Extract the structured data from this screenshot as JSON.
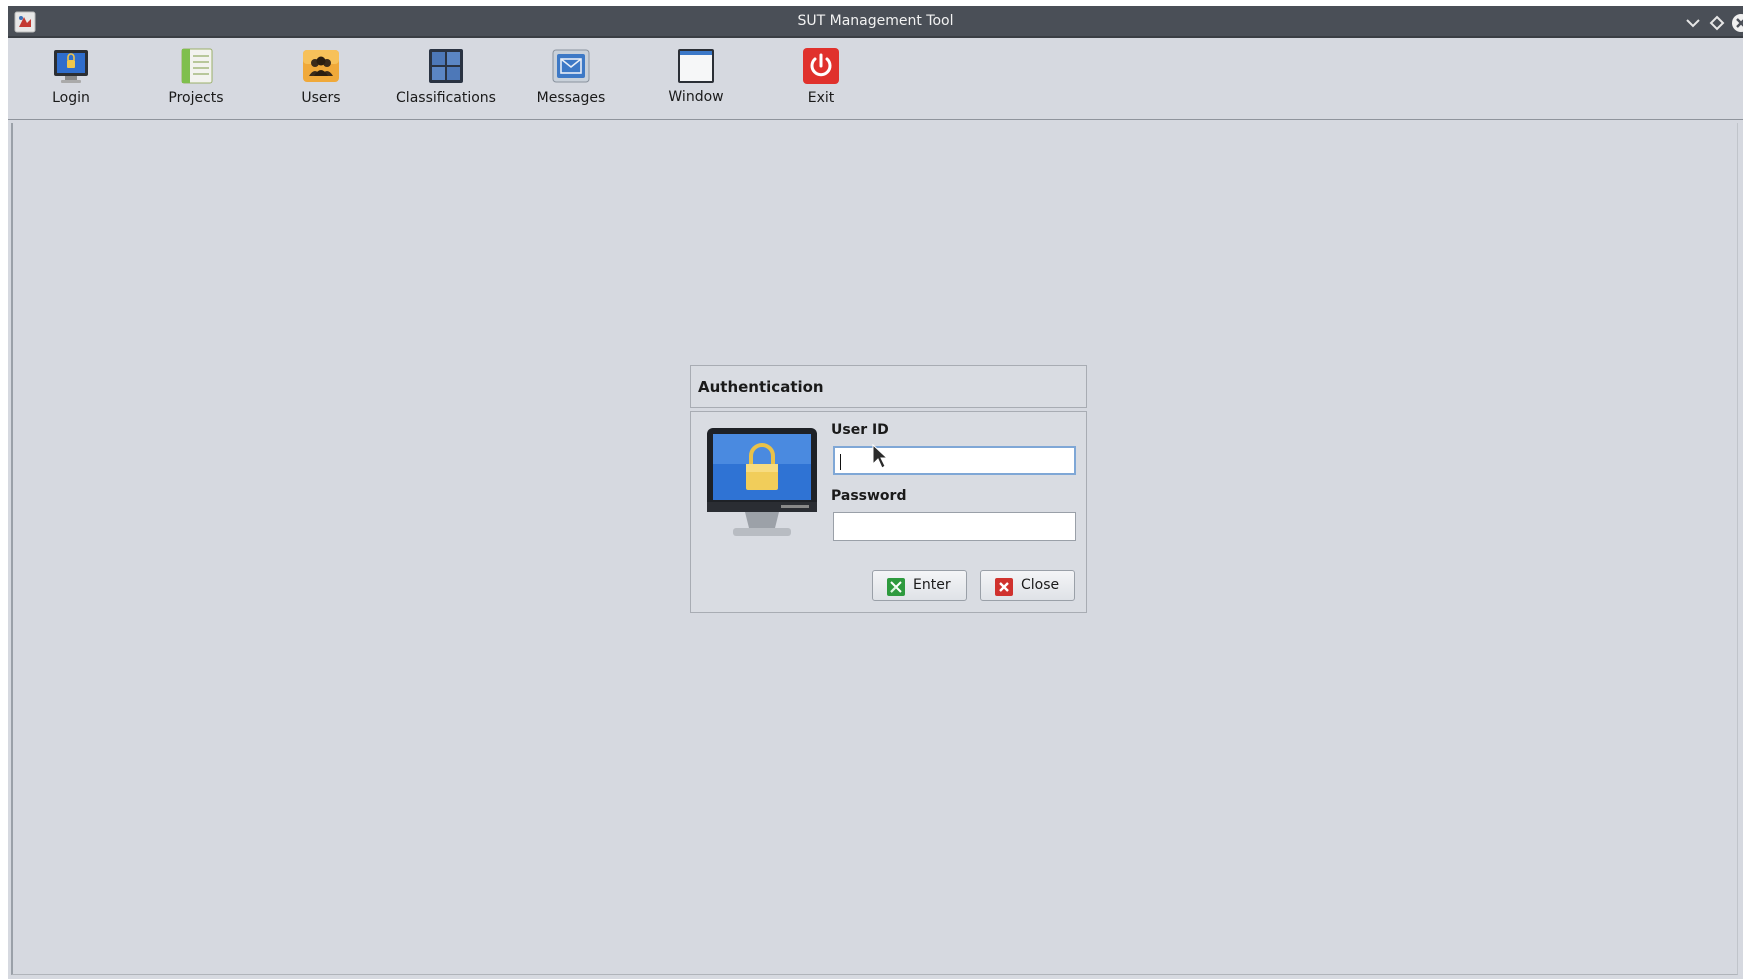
{
  "window": {
    "title": "SUT Management Tool"
  },
  "toolbar": {
    "items": [
      {
        "label": "Login",
        "icon": "login-monitor-icon"
      },
      {
        "label": "Projects",
        "icon": "projects-icon"
      },
      {
        "label": "Users",
        "icon": "users-icon"
      },
      {
        "label": "Classifications",
        "icon": "classifications-icon"
      },
      {
        "label": "Messages",
        "icon": "messages-icon"
      },
      {
        "label": "Window",
        "icon": "window-icon"
      },
      {
        "label": "Exit",
        "icon": "power-icon"
      }
    ]
  },
  "dialog": {
    "title": "Authentication",
    "user_id_label": "User ID",
    "user_id_value": "",
    "password_label": "Password",
    "password_value": "",
    "enter_label": "Enter",
    "close_label": "Close"
  },
  "colors": {
    "titlebar": "#4a4f57",
    "background": "#d6d9e0",
    "focus_border": "#7fa7d6",
    "enter_icon": "#2e9a3e",
    "close_icon": "#d0322e",
    "exit_icon": "#e0312c"
  }
}
